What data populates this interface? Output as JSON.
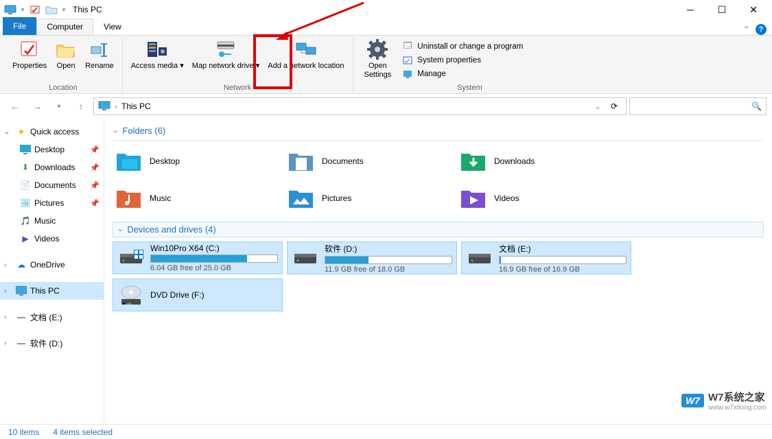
{
  "title": "This PC",
  "tabs": {
    "file": "File",
    "computer": "Computer",
    "view": "View"
  },
  "ribbon": {
    "location": {
      "label": "Location",
      "properties": "Properties",
      "open": "Open",
      "rename": "Rename"
    },
    "network": {
      "label": "Network",
      "access_media": "Access media",
      "map_drive": "Map network drive",
      "add_location": "Add a network location"
    },
    "open_settings": {
      "line1": "Open",
      "line2": "Settings"
    },
    "system": {
      "label": "System",
      "uninstall": "Uninstall or change a program",
      "properties": "System properties",
      "manage": "Manage"
    }
  },
  "address": {
    "location": "This PC"
  },
  "search": {
    "placeholder": ""
  },
  "sidebar": {
    "quick_access": "Quick access",
    "items": [
      {
        "label": "Desktop",
        "pin": true
      },
      {
        "label": "Downloads",
        "pin": true
      },
      {
        "label": "Documents",
        "pin": true
      },
      {
        "label": "Pictures",
        "pin": true
      },
      {
        "label": "Music",
        "pin": false
      },
      {
        "label": "Videos",
        "pin": false
      }
    ],
    "onedrive": "OneDrive",
    "this_pc": "This PC",
    "drive_e": "文档 (E:)",
    "drive_d": "软件 (D:)"
  },
  "sections": {
    "folders_header": "Folders (6)",
    "folders": [
      "Desktop",
      "Documents",
      "Downloads",
      "Music",
      "Pictures",
      "Videos"
    ],
    "drives_header": "Devices and drives (4)",
    "drives": [
      {
        "name": "Win10Pro X64 (C:)",
        "free": "6.04 GB free of 25.0 GB",
        "pct": 76
      },
      {
        "name": "软件 (D:)",
        "free": "11.9 GB free of 18.0 GB",
        "pct": 34
      },
      {
        "name": "文档 (E:)",
        "free": "16.9 GB free of 16.9 GB",
        "pct": 1
      },
      {
        "name": "DVD Drive (F:)",
        "free": "",
        "pct": -1
      }
    ]
  },
  "status": {
    "items": "10 items",
    "selected": "4 items selected"
  },
  "watermark": {
    "logo": "W7",
    "text": "W7系统之家",
    "url": "www.w7xitong.com"
  }
}
